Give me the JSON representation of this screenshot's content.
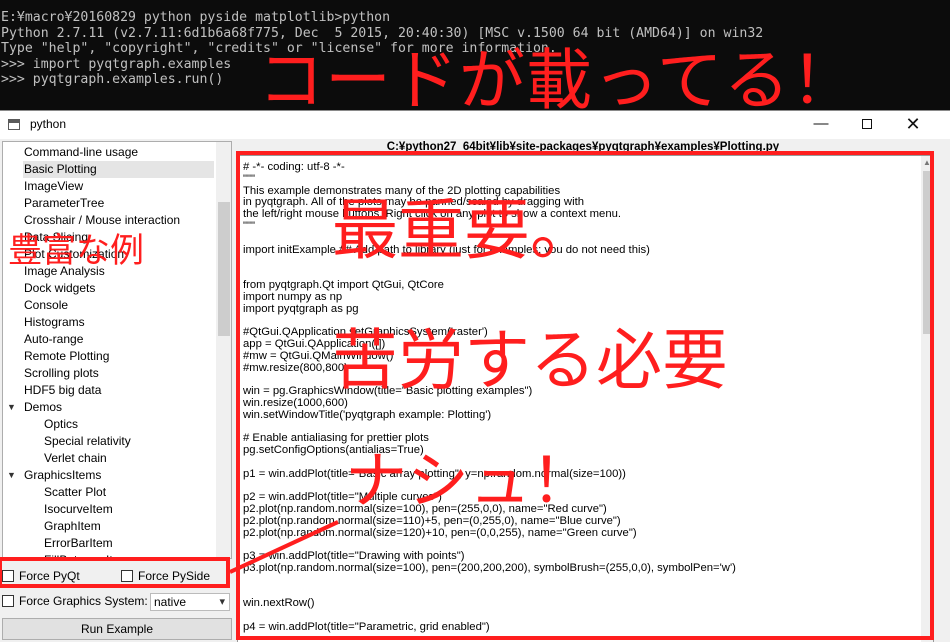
{
  "console": {
    "lines": [
      "E:¥macro¥20160829 python pyside matplotlib>python",
      "Python 2.7.11 (v2.7.11:6d1b6a68f775, Dec  5 2015, 20:40:30) [MSC v.1500 64 bit (AMD64)] on win32",
      "Type \"help\", \"copyright\", \"credits\" or \"license\" for more information.",
      ">>> import pyqtgraph.examples",
      ">>> pyqtgraph.examples.run()"
    ]
  },
  "window": {
    "title": "python",
    "icon": "app-window-icon",
    "controls": {
      "minimize": "—",
      "maximize": "□",
      "close": "✕"
    }
  },
  "tree": {
    "items": [
      {
        "label": "Command-line usage",
        "level": 0
      },
      {
        "label": "Basic Plotting",
        "level": 0,
        "selected": true
      },
      {
        "label": "ImageView",
        "level": 0
      },
      {
        "label": "ParameterTree",
        "level": 0
      },
      {
        "label": "Crosshair / Mouse interaction",
        "level": 0
      },
      {
        "label": "Data Slicing",
        "level": 0
      },
      {
        "label": "Plot Customization",
        "level": 0
      },
      {
        "label": "Image Analysis",
        "level": 0
      },
      {
        "label": "Dock widgets",
        "level": 0
      },
      {
        "label": "Console",
        "level": 0
      },
      {
        "label": "Histograms",
        "level": 0
      },
      {
        "label": "Auto-range",
        "level": 0
      },
      {
        "label": "Remote Plotting",
        "level": 0
      },
      {
        "label": "Scrolling plots",
        "level": 0
      },
      {
        "label": "HDF5 big data",
        "level": 0
      },
      {
        "label": "Demos",
        "level": 0,
        "expanded": true
      },
      {
        "label": "Optics",
        "level": 1
      },
      {
        "label": "Special relativity",
        "level": 1
      },
      {
        "label": "Verlet chain",
        "level": 1
      },
      {
        "label": "GraphicsItems",
        "level": 0,
        "expanded": true
      },
      {
        "label": "Scatter Plot",
        "level": 1
      },
      {
        "label": "IsocurveItem",
        "level": 1
      },
      {
        "label": "GraphItem",
        "level": 1
      },
      {
        "label": "ErrorBarItem",
        "level": 1
      },
      {
        "label": "FillBetweenItem",
        "level": 1
      }
    ]
  },
  "controls": {
    "force_pyqt": "Force PyQt",
    "force_pyside": "Force PySide",
    "force_graphics_system": "Force Graphics System:",
    "graphics_system_value": "native",
    "run_button": "Run Example"
  },
  "code_pane": {
    "file_path": "C:¥python27_64bit¥lib¥site-packages¥pyqtgraph¥examples¥Plotting.py",
    "lines": [
      "# -*- coding: utf-8 -*-",
      "\"\"\"",
      "This example demonstrates many of the 2D plotting capabilities",
      "in pyqtgraph. All of the plots may be panned/scaled by dragging with",
      "the left/right mouse buttons. Right click on any plot to show a context menu.",
      "\"\"\"",
      "",
      "import initExample ## Add path to library (just for examples; you do not need this)",
      "",
      "",
      "from pyqtgraph.Qt import QtGui, QtCore",
      "import numpy as np",
      "import pyqtgraph as pg",
      "",
      "#QtGui.QApplication.setGraphicsSystem('raster')",
      "app = QtGui.QApplication([])",
      "#mw = QtGui.QMainWindow()",
      "#mw.resize(800,800)",
      "",
      "win = pg.GraphicsWindow(title=\"Basic plotting examples\")",
      "win.resize(1000,600)",
      "win.setWindowTitle('pyqtgraph example: Plotting')",
      "",
      "# Enable antialiasing for prettier plots",
      "pg.setConfigOptions(antialias=True)",
      "",
      "p1 = win.addPlot(title=\"Basic array plotting\", y=np.random.normal(size=100))",
      "",
      "p2 = win.addPlot(title=\"Multiple curves\")",
      "p2.plot(np.random.normal(size=100), pen=(255,0,0), name=\"Red curve\")",
      "p2.plot(np.random.normal(size=110)+5, pen=(0,255,0), name=\"Blue curve\")",
      "p2.plot(np.random.normal(size=120)+10, pen=(0,0,255), name=\"Green curve\")",
      "",
      "p3 = win.addPlot(title=\"Drawing with points\")",
      "p3.plot(np.random.normal(size=100), pen=(200,200,200), symbolBrush=(255,0,0), symbolPen='w')",
      "",
      "",
      "win.nextRow()",
      "",
      "p4 = win.addPlot(title=\"Parametric, grid enabled\")"
    ]
  },
  "annotations": {
    "color": "#ff1e1e",
    "code_shown": "コードが載ってる！",
    "many_examples": "豊富な例",
    "most_important": "最重要。",
    "hard_work": "苦労する必要",
    "gyu": "ナシュ！"
  }
}
